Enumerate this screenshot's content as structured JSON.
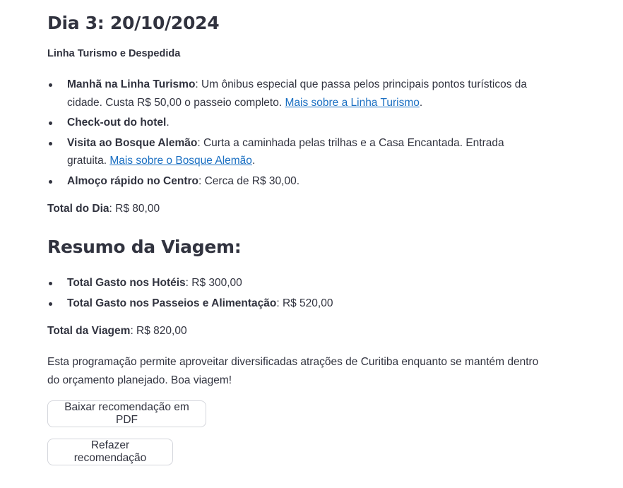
{
  "day": {
    "title": "Dia 3: 20/10/2024",
    "subtitle": "Linha Turismo e Despedida",
    "items": [
      {
        "bold": "Manhã na Linha Turismo",
        "text": ": Um ônibus especial que passa pelos principais pontos turísticos da cidade. Custa R$ 50,00 o passeio completo. ",
        "link": "Mais sobre a Linha Turismo",
        "after": "."
      },
      {
        "bold": "Check-out do hotel",
        "text": ".",
        "link": "",
        "after": ""
      },
      {
        "bold": "Visita ao Bosque Alemão",
        "text": ": Curta a caminhada pelas trilhas e a Casa Encantada. Entrada gratuita. ",
        "link": "Mais sobre o Bosque Alemão",
        "after": "."
      },
      {
        "bold": "Almoço rápido no Centro",
        "text": ": Cerca de R$ 30,00.",
        "link": "",
        "after": ""
      }
    ],
    "total_label": "Total do Dia",
    "total_value": ": R$ 80,00"
  },
  "summary": {
    "title": "Resumo da Viagem:",
    "items": [
      {
        "bold": "Total Gasto nos Hotéis",
        "text": ": R$ 300,00"
      },
      {
        "bold": "Total Gasto nos Passeios e Alimentação",
        "text": ": R$ 520,00"
      }
    ],
    "total_label": "Total da Viagem",
    "total_value": ": R$ 820,00",
    "closing": "Esta programação permite aproveitar diversificadas atrações de Curitiba enquanto se mantém dentro do orçamento planejado. Boa viagem!"
  },
  "buttons": {
    "download_pdf": "Baixar recomendação em PDF",
    "redo": "Refazer recomendação"
  }
}
